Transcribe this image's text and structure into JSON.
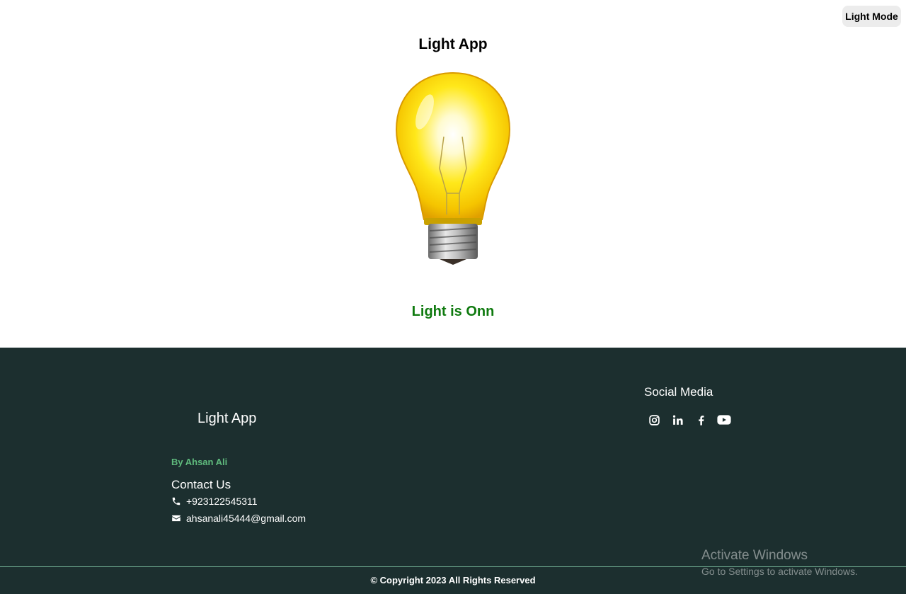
{
  "toggle": {
    "label": "Light Mode"
  },
  "header": {
    "title": "Light App"
  },
  "bulb": {
    "state": "on",
    "icon": "light-bulb-icon"
  },
  "status": {
    "text": "Light is Onn",
    "color": "#0f7a0f"
  },
  "footer": {
    "title": "Light App",
    "byline": "By Ahsan Ali",
    "byline_color": "#5fba7d",
    "contact": {
      "title": "Contact Us",
      "phone": "+923122545311",
      "email": "ahsanali45444@gmail.com"
    },
    "social": {
      "title": "Social Media",
      "icons": [
        "instagram-icon",
        "linkedin-icon",
        "facebook-icon",
        "youtube-icon"
      ]
    },
    "copyright": "© Copyright 2023 All Rights Reserved",
    "background": "#1c2f2f"
  },
  "watermark": {
    "line1": "Activate Windows",
    "line2": "Go to Settings to activate Windows."
  }
}
